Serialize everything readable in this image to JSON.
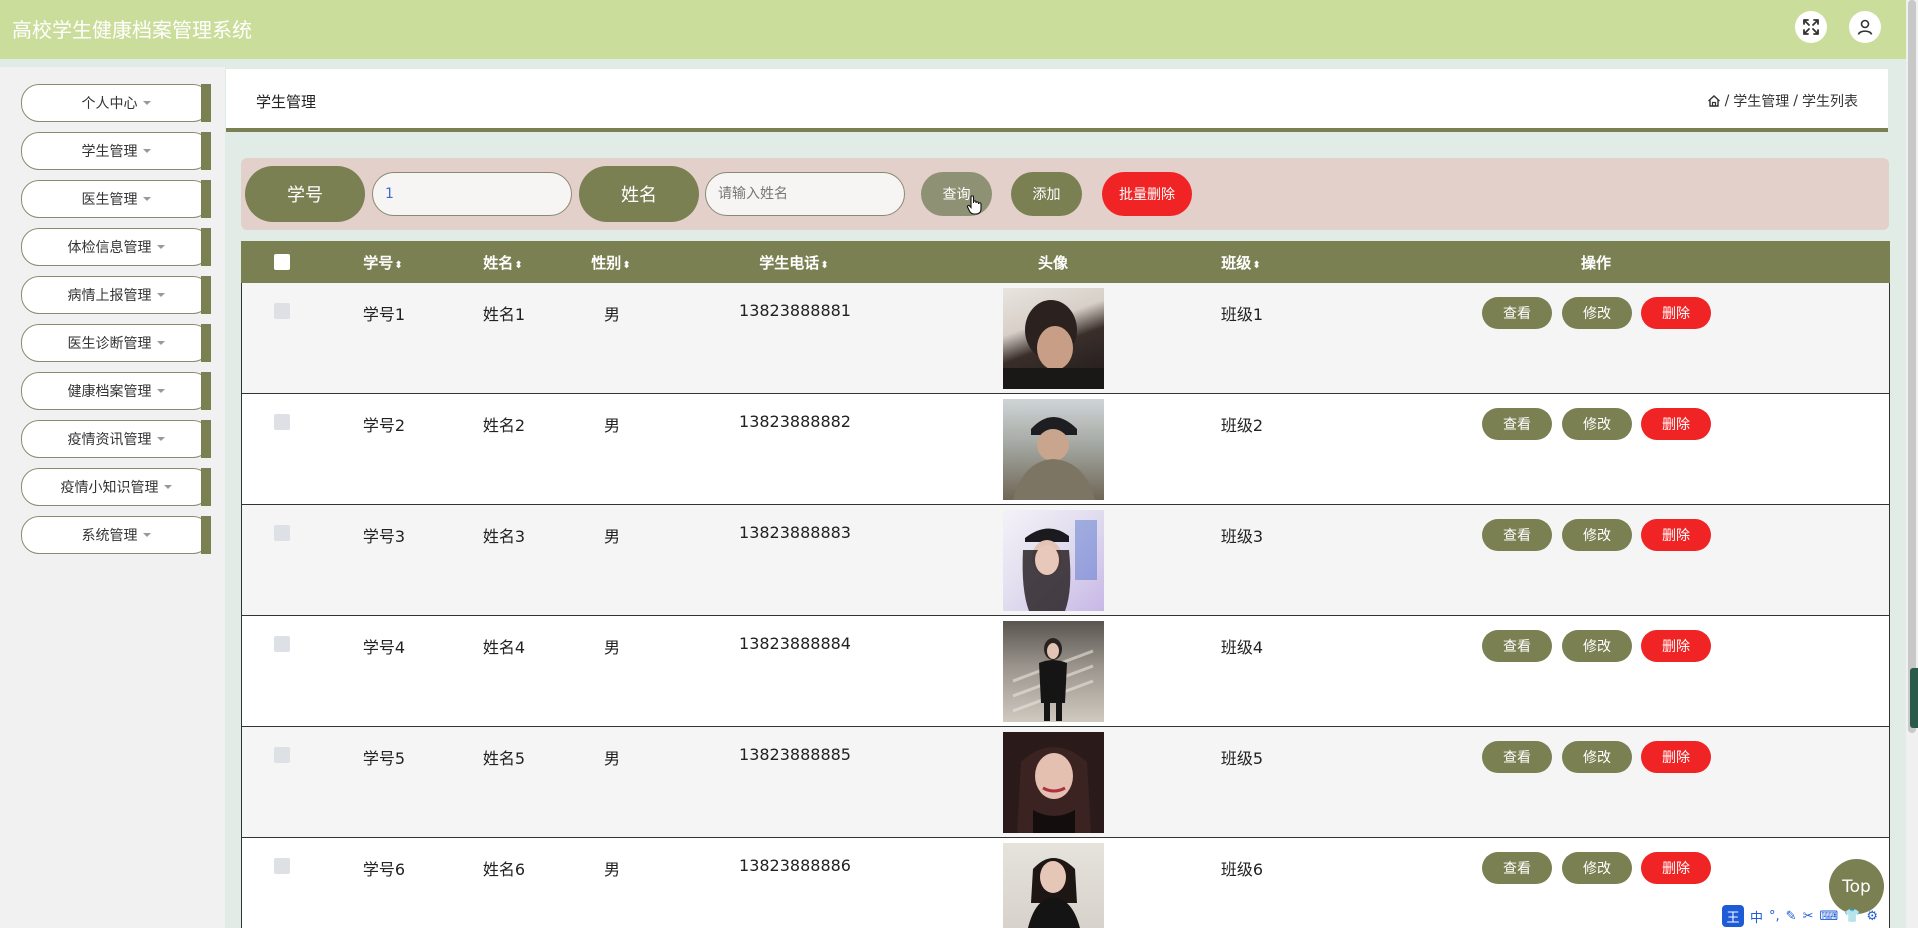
{
  "app": {
    "title": "高校学生健康档案管理系统"
  },
  "topbar": {
    "fullscreen_icon": "expand-icon",
    "user_icon": "user-icon"
  },
  "sidebar": {
    "items": [
      {
        "label": "个人中心"
      },
      {
        "label": "学生管理"
      },
      {
        "label": "医生管理"
      },
      {
        "label": "体检信息管理"
      },
      {
        "label": "病情上报管理"
      },
      {
        "label": "医生诊断管理"
      },
      {
        "label": "健康档案管理"
      },
      {
        "label": "疫情资讯管理"
      },
      {
        "label": "疫情小知识管理"
      },
      {
        "label": "系统管理"
      }
    ]
  },
  "header": {
    "title": "学生管理",
    "breadcrumb": [
      "学生管理",
      "学生列表"
    ]
  },
  "search": {
    "student_id_label": "学号",
    "student_id_value": "1",
    "name_label": "姓名",
    "name_placeholder": "请输入姓名",
    "query_label": "查询",
    "add_label": "添加",
    "batch_delete_label": "批量删除"
  },
  "table": {
    "columns": [
      "学号",
      "姓名",
      "性别",
      "学生电话",
      "头像",
      "班级",
      "操作"
    ],
    "rows": [
      {
        "student_id": "学号1",
        "name": "姓名1",
        "gender": "男",
        "phone": "13823888881",
        "class": "班级1"
      },
      {
        "student_id": "学号2",
        "name": "姓名2",
        "gender": "男",
        "phone": "13823888882",
        "class": "班级2"
      },
      {
        "student_id": "学号3",
        "name": "姓名3",
        "gender": "男",
        "phone": "13823888883",
        "class": "班级3"
      },
      {
        "student_id": "学号4",
        "name": "姓名4",
        "gender": "男",
        "phone": "13823888884",
        "class": "班级4"
      },
      {
        "student_id": "学号5",
        "name": "姓名5",
        "gender": "男",
        "phone": "13823888885",
        "class": "班级5"
      },
      {
        "student_id": "学号6",
        "name": "姓名6",
        "gender": "男",
        "phone": "13823888886",
        "class": "班级6"
      }
    ],
    "actions": {
      "view": "查看",
      "edit": "修改",
      "delete": "删除"
    }
  },
  "fab": {
    "top_label": "Top"
  },
  "ime": {
    "logo": "王",
    "mode": "中"
  },
  "colors": {
    "topbar": "#cbdd9b",
    "accent": "#7a8052",
    "danger": "#f02424",
    "search_bar": "#e3d0ca",
    "background": "#e2ece6"
  }
}
